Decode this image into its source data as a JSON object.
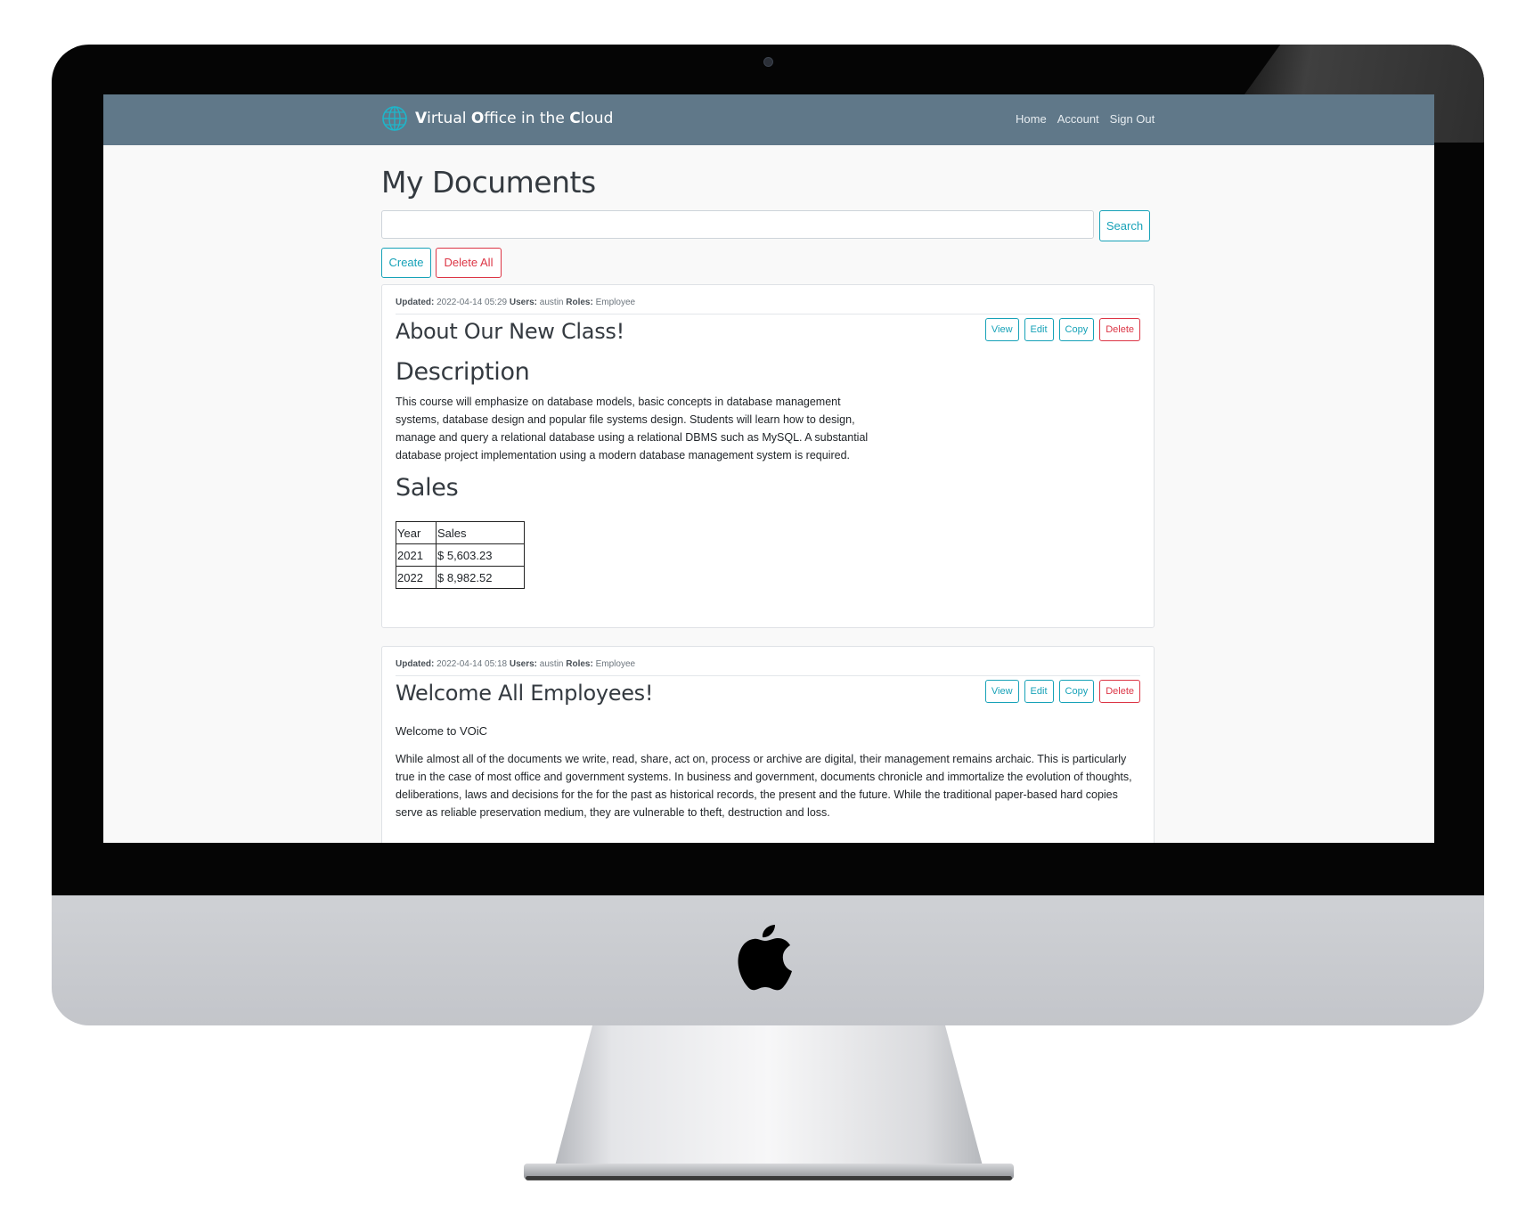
{
  "app": {
    "brand": {
      "part1_bold": "V",
      "part1": "irtual ",
      "part2_bold": "O",
      "part2": "ffice in the ",
      "part3_bold": "C",
      "part3": "loud"
    },
    "nav": [
      "Home",
      "Account",
      "Sign Out"
    ],
    "accent_color": "#17a2b8",
    "danger_color": "#dc3545",
    "navbar_color": "#607889"
  },
  "page": {
    "title": "My Documents",
    "search": {
      "value": "",
      "button_label": "Search"
    },
    "create_label": "Create",
    "delete_all_label": "Delete All"
  },
  "documents": [
    {
      "updated_label": "Updated:",
      "updated": "2022-04-14 05:29",
      "users_label": "Users:",
      "users": "austin",
      "roles_label": "Roles:",
      "roles": "Employee",
      "title": "About Our New Class!",
      "buttons": {
        "view": "View",
        "edit": "Edit",
        "copy": "Copy",
        "delete": "Delete"
      },
      "heading1": "Description",
      "description": "This course will emphasize on database models, basic concepts in database management systems, database design and popular file systems design. Students will learn how to design, manage and query a relational database using a relational DBMS such as MySQL. A substantial database project implementation using a modern database management system is required.",
      "heading2": "Sales",
      "sales_table": {
        "headers": [
          "Year",
          "Sales"
        ],
        "rows": [
          [
            "2021",
            "$ 5,603.23"
          ],
          [
            "2022",
            "$ 8,982.52"
          ]
        ]
      }
    },
    {
      "updated_label": "Updated:",
      "updated": "2022-04-14 05:18",
      "users_label": "Users:",
      "users": "austin",
      "roles_label": "Roles:",
      "roles": "Employee",
      "title": "Welcome All Employees!",
      "buttons": {
        "view": "View",
        "edit": "Edit",
        "copy": "Copy",
        "delete": "Delete"
      },
      "intro": "Welcome to VOiC",
      "body": "While almost all of the documents we write, read, share, act on, process or archive are digital, their management remains archaic. This is particularly true in the case of most office and government systems. In business and government, documents chronicle and immortalize the evolution of thoughts, deliberations, laws and decisions for the for the past as historical records, the present and the future. While the traditional paper-based hard copies serve as reliable preservation medium, they are vulnerable to theft, destruction and loss."
    }
  ]
}
